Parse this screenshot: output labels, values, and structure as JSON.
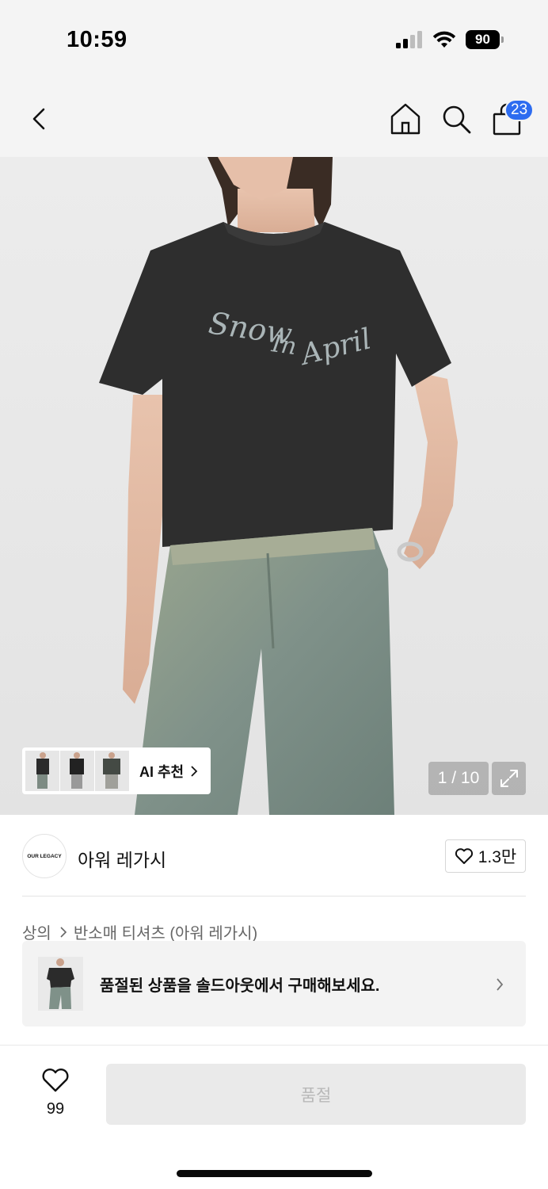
{
  "status_bar": {
    "time": "10:59",
    "battery_level": "90",
    "signal_icon": "cellular-signal-icon",
    "wifi_icon": "wifi-icon"
  },
  "nav": {
    "back_icon": "chevron-left-icon",
    "home_icon": "home-icon",
    "search_icon": "search-icon",
    "bag_icon": "shopping-bag-icon",
    "bag_count": "23",
    "badge_color": "#2d6cf0"
  },
  "hero": {
    "shirt_print": "Snow In April",
    "page_counter": "1 / 10",
    "ai_recommend_label": "AI 추천",
    "expand_icon": "expand-icon"
  },
  "brand": {
    "logo_text": "OUR LEGACY",
    "name": "아워 레가시",
    "like_count": "1.3만"
  },
  "breadcrumb": {
    "category": "상의",
    "subcategory": "반소매 티셔츠 (아워 레가시)"
  },
  "soldout_banner": {
    "message": "품절된 상품을 솔드아웃에서 구매해보세요."
  },
  "bottom_bar": {
    "wish_count": "99",
    "buy_button_label": "품절"
  }
}
